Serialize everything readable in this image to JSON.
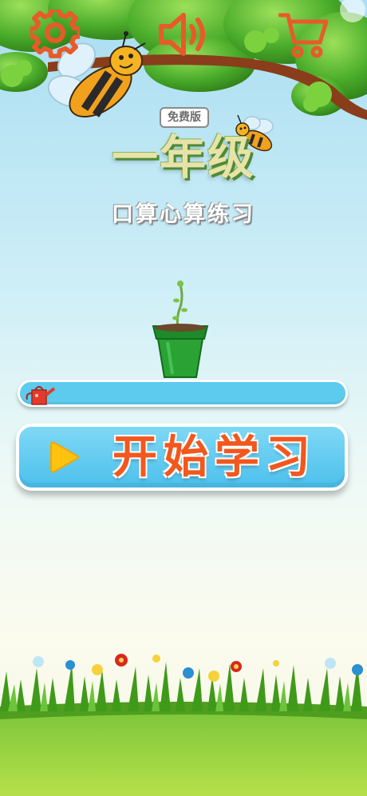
{
  "toolbar": {
    "settings_icon": "gear-icon",
    "sound_icon": "speaker-icon",
    "cart_icon": "shopping-cart-icon",
    "icon_color": "#e85a2a"
  },
  "title": {
    "badge": "免费版",
    "main": "一年级",
    "subtitle": "口算心算练习"
  },
  "progress": {
    "value": 0,
    "icon": "watering-can-icon"
  },
  "start_button": {
    "label": "开始学习",
    "icon": "play-icon"
  },
  "colors": {
    "accent_blue": "#5ccbee",
    "button_text": "#f2571d",
    "play": "#ffc20e"
  }
}
